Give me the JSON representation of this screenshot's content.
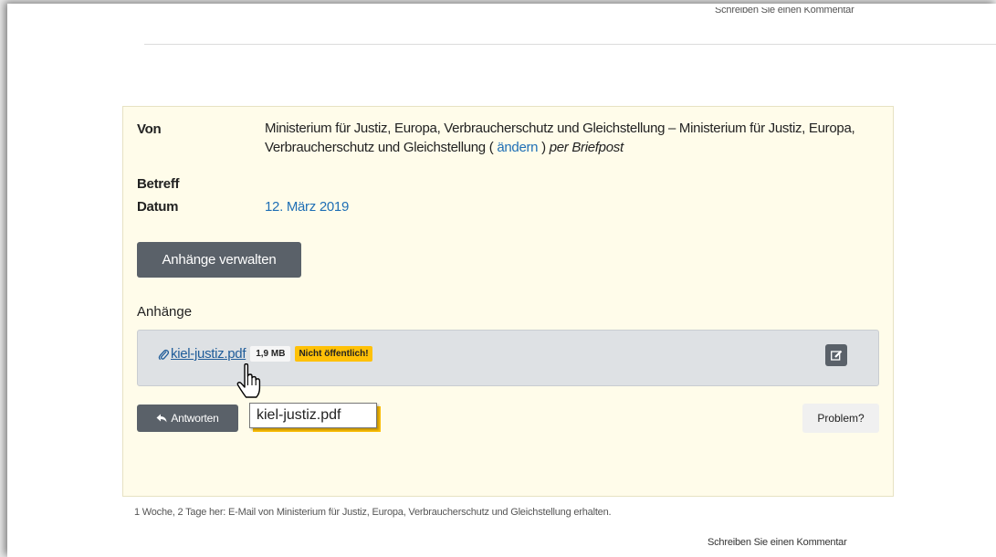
{
  "top_comment_link": "Schreiben Sie einen Kommentar",
  "message": {
    "from_label": "Von",
    "from_value": "Ministerium für Justiz, Europa, Verbraucherschutz und Gleichstellung – Ministerium für Justiz, Europa, Verbraucherschutz und Gleichstellung",
    "from_open_paren": "(",
    "from_change_link": "ändern",
    "from_close_paren": ")",
    "from_method": "per Briefpost",
    "subject_label": "Betreff",
    "date_label": "Datum",
    "date_value": "12. März 2019"
  },
  "manage_attachments_button": "Anhänge verwalten",
  "attachments": {
    "heading": "Anhänge",
    "items": [
      {
        "filename": "kiel-justiz.pdf",
        "size": "1,9 MB",
        "badge": "Nicht öffentlich!"
      }
    ]
  },
  "reply_button": "Antworten",
  "tooltip_text": "kiel-justiz.pdf",
  "problem_button": "Problem?",
  "footer_note": "1 Woche, 2 Tage her: E-Mail von Ministerium für Justiz, Europa, Verbraucherschutz und Gleichstellung erhalten.",
  "bottom_comment_link": "Schreiben Sie einen Kommentar",
  "colors": {
    "box_background": "#fffcea",
    "link": "#1f6fb5",
    "button_dark": "#5a6169",
    "warning_badge": "#ffc107"
  },
  "icons": [
    "paperclip-icon",
    "edit-icon",
    "reply-arrow-icon",
    "hand-pointer-cursor-icon"
  ]
}
